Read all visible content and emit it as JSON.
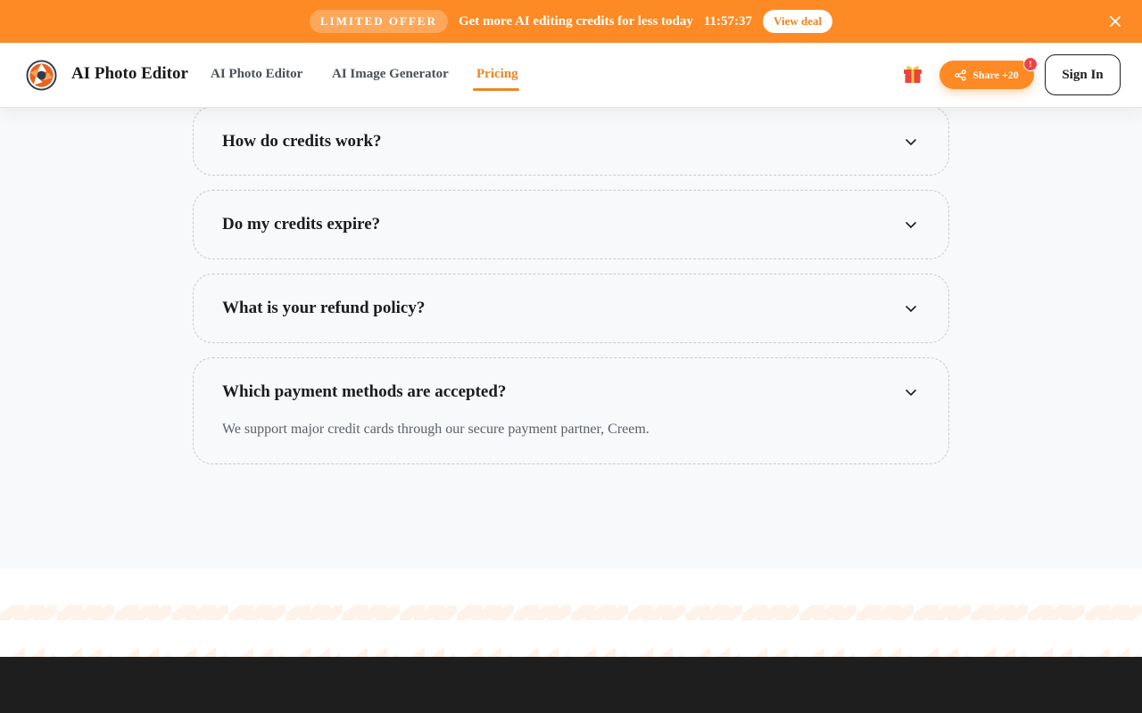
{
  "promo": {
    "badge": "LIMITED OFFER",
    "text": "Get more AI editing credits for less today",
    "timer": "11:57:37",
    "button": "View deal",
    "close_icon": "close-icon"
  },
  "header": {
    "brand": "AI Photo Editor",
    "nav": [
      {
        "label": "AI Photo Editor",
        "active": false
      },
      {
        "label": "AI Image Generator",
        "active": false
      },
      {
        "label": "Pricing",
        "active": true
      }
    ],
    "gift_icon": "gift-icon",
    "share_label": "Share +20",
    "share_badge": "!",
    "signin_label": "Sign In"
  },
  "faq": [
    {
      "question": "How do credits work?",
      "answer": "",
      "expanded": false
    },
    {
      "question": "Do my credits expire?",
      "answer": "",
      "expanded": false
    },
    {
      "question": "What is your refund policy?",
      "answer": "",
      "expanded": false
    },
    {
      "question": "Which payment methods are accepted?",
      "answer": "We support major credit cards through our secure payment partner, Creem.",
      "expanded": true
    }
  ],
  "colors": {
    "accent": "#fd8a24",
    "footer": "#1e1e1e",
    "background": "#f8f9fb"
  }
}
